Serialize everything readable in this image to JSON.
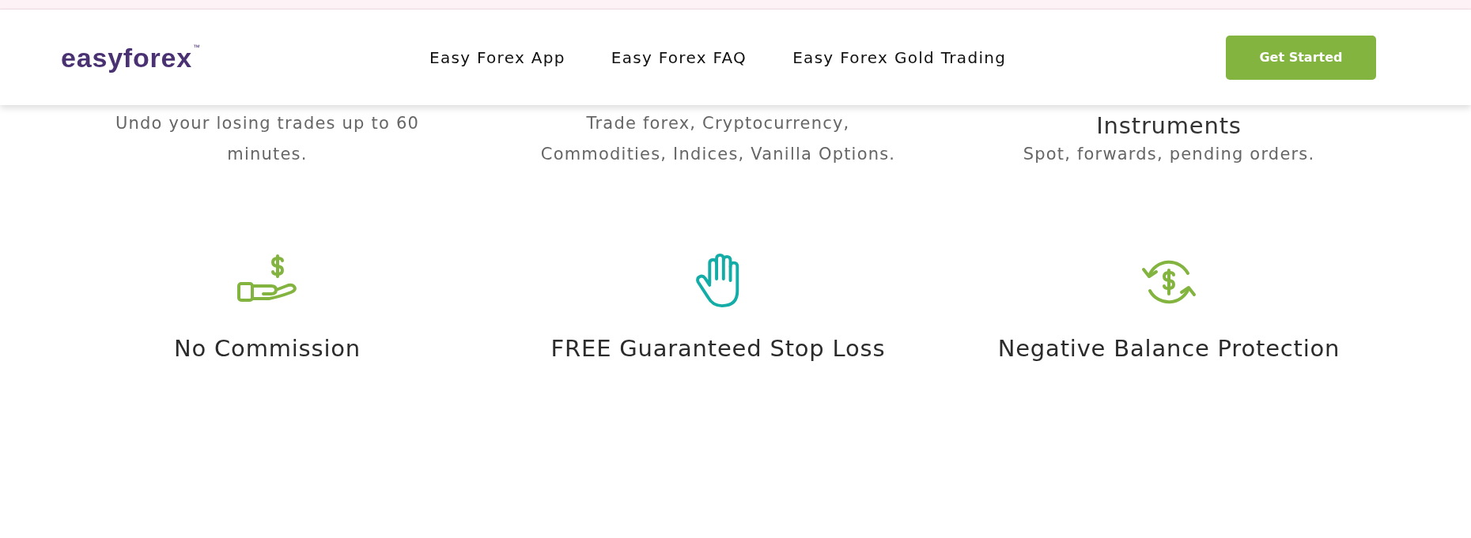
{
  "header": {
    "logo": "easyforex$^{™}$",
    "nav": [
      {
        "label": "Easy Forex App"
      },
      {
        "label": "Easy Forex FAQ"
      },
      {
        "label": "Easy Forex Gold Trading"
      }
    ],
    "cta": "Get Started"
  },
  "top_features": [
    {
      "description": "Undo your losing trades up to 60 minutes."
    },
    {
      "description": "Trade forex, Cryptocurrency, Commodities, Indices, Vanilla Options."
    },
    {
      "title": "Instruments",
      "description": "Spot, forwards, pending orders."
    }
  ],
  "features": [
    {
      "title": "No Commission"
    },
    {
      "title": "FREE Guaranteed Stop Loss"
    },
    {
      "title": "Negative Balance Protection"
    }
  ]
}
